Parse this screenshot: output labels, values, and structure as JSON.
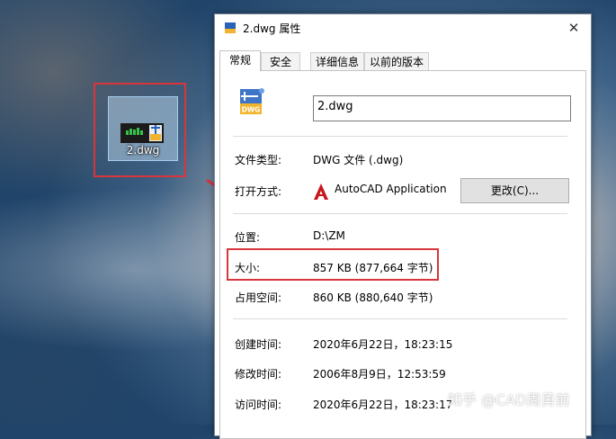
{
  "desktop": {
    "icon_label": "2.dwg"
  },
  "dialog": {
    "title": "2.dwg 属性",
    "close_glyph": "✕",
    "tabs": [
      {
        "label": "常规",
        "active": true
      },
      {
        "label": "安全",
        "active": false
      },
      {
        "label": "详细信息",
        "active": false
      },
      {
        "label": "以前的版本",
        "active": false
      }
    ],
    "file_icon": "dwg-file-icon",
    "file_name": "2.dwg",
    "file_type_label": "文件类型:",
    "file_type_value": "DWG 文件 (.dwg)",
    "open_with_label": "打开方式:",
    "open_with_value": "AutoCAD Application",
    "change_button": "更改(C)...",
    "location_label": "位置:",
    "location_value": "D:\\ZM",
    "size_label": "大小:",
    "size_value": "857 KB (877,664 字节)",
    "size_on_disk_label": "占用空间:",
    "size_on_disk_value": "860 KB (880,640 字节)",
    "created_label": "创建时间:",
    "created_value": "2020年6月22日，18:23:15",
    "modified_label": "修改时间:",
    "modified_value": "2006年8月9日，12:53:59",
    "accessed_label": "访问时间:",
    "accessed_value": "2020年6月22日，18:23:17"
  },
  "annotation": {
    "highlight_color": "#d8363b"
  },
  "watermark": "知乎 @CAD周勇前"
}
